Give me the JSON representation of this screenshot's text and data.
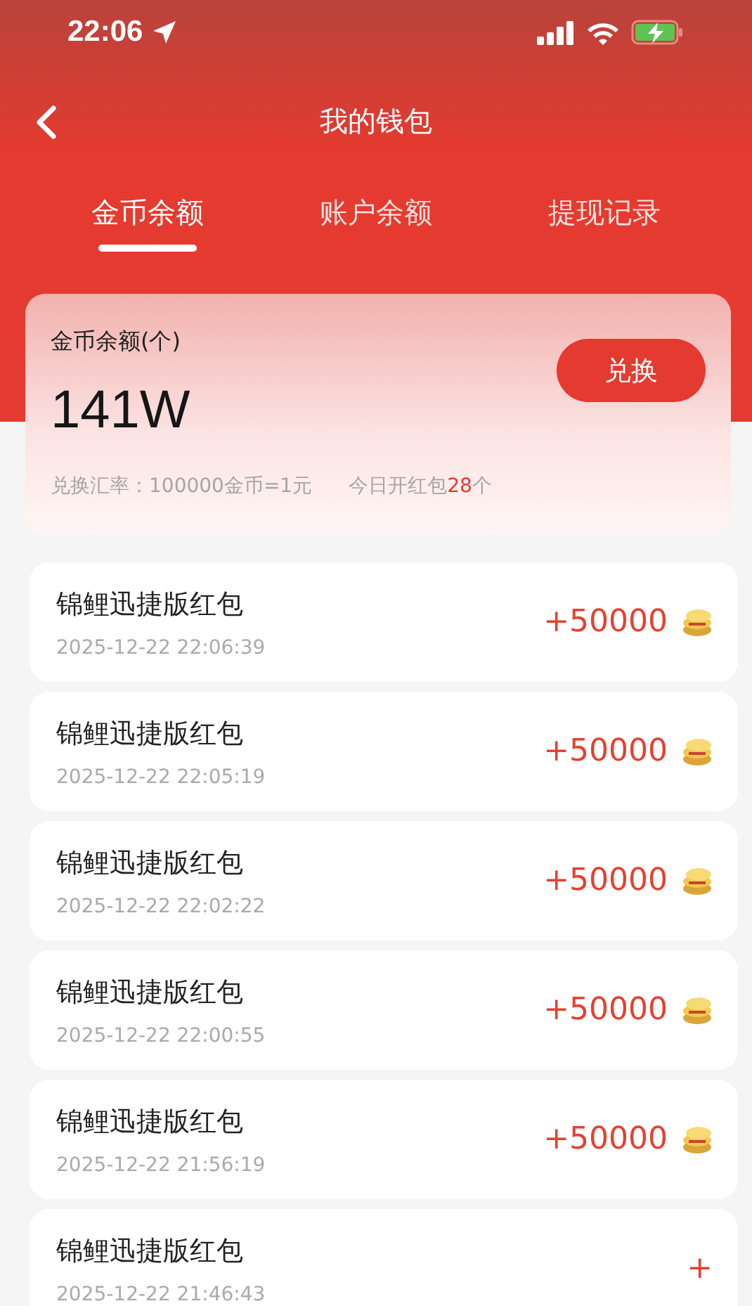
{
  "status_bar": {
    "time": "22:06"
  },
  "nav": {
    "title": "我的钱包"
  },
  "tabs": [
    {
      "label": "金币余额",
      "selected": true
    },
    {
      "label": "账户余额",
      "selected": false
    },
    {
      "label": "提现记录",
      "selected": false
    }
  ],
  "balance_card": {
    "label": "金币余额(个)",
    "amount": "141W",
    "button": "兑换",
    "rate": "兑换汇率：100000金币=1元",
    "today_prefix": "今日开红包",
    "today_count": "28",
    "today_suffix": "个"
  },
  "records": [
    {
      "title": "锦鲤迅捷版红包",
      "time": "2025-12-22 22:06:39",
      "amount": "+50000",
      "coin": true
    },
    {
      "title": "锦鲤迅捷版红包",
      "time": "2025-12-22 22:05:19",
      "amount": "+50000",
      "coin": true
    },
    {
      "title": "锦鲤迅捷版红包",
      "time": "2025-12-22 22:02:22",
      "amount": "+50000",
      "coin": true
    },
    {
      "title": "锦鲤迅捷版红包",
      "time": "2025-12-22 22:00:55",
      "amount": "+50000",
      "coin": true
    },
    {
      "title": "锦鲤迅捷版红包",
      "time": "2025-12-22 21:56:19",
      "amount": "+50000",
      "coin": true
    },
    {
      "title": "锦鲤迅捷版红包",
      "time": "2025-12-22 21:46:43",
      "amount": "+",
      "coin": false
    }
  ]
}
